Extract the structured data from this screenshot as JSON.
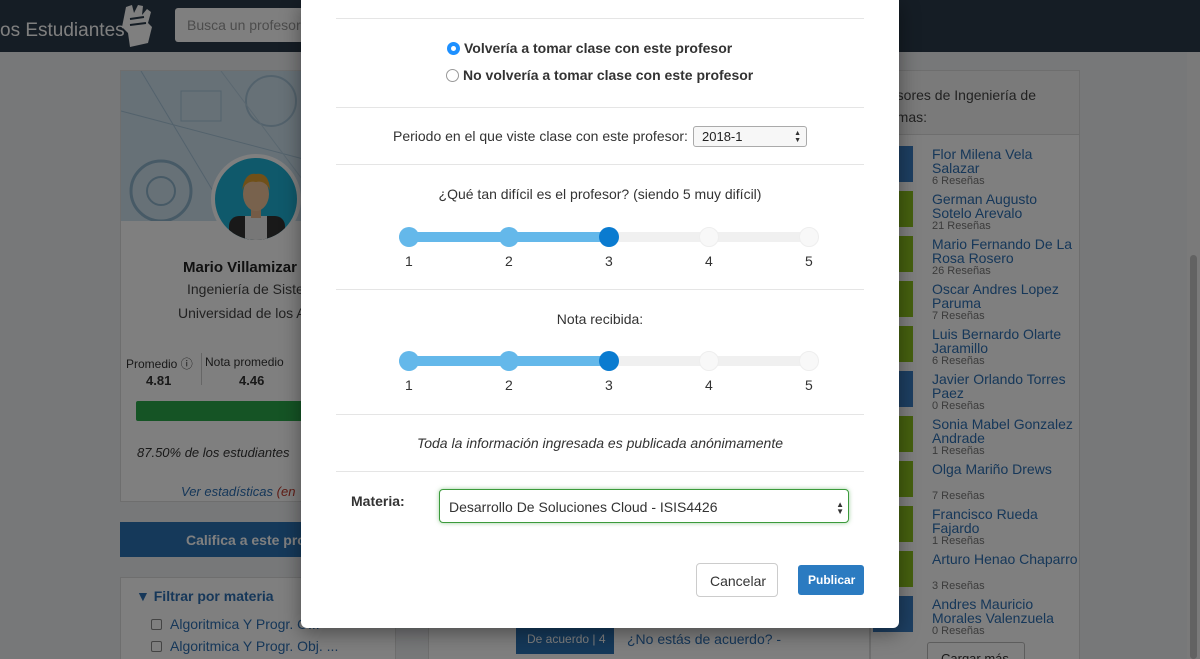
{
  "header": {
    "brand": "os Estudiantes",
    "search_placeholder": "Busca un profesor"
  },
  "profile": {
    "name": "Mario Villamizar",
    "department": "Ingeniería de Siste",
    "university": "Universidad de los A",
    "promedio_label": "Promedio",
    "promedio_value": "4.81",
    "nota_label": "Nota promedio",
    "nota_value": "4.46",
    "percent_text": "87.50% de los estudiantes",
    "stats_link": "Ver estadísticas",
    "stats_link_suffix": "(en",
    "rate_button": "Califica a este prof"
  },
  "filter": {
    "title": "Filtrar por materia",
    "items": [
      "Algoritmica Y Progr. O...",
      "Algoritmica Y Progr. Obj. ..."
    ]
  },
  "review": {
    "agree_button": "De acuerdo | 4",
    "disagree_link": "¿No estás de acuerdo?  -"
  },
  "sidebar": {
    "title": "fesores de Ingeniería de temas:",
    "load_more": "Cargar más",
    "professors": [
      {
        "name": "Flor Milena Vela Salazar",
        "reviews": "6 Reseñas",
        "color": "#3b7fc4"
      },
      {
        "name": "German Augusto Sotelo Arevalo",
        "reviews": "21 Reseñas",
        "color": "#8dc21f"
      },
      {
        "name": "Mario Fernando De La Rosa Rosero",
        "reviews": "26 Reseñas",
        "color": "#8dc21f"
      },
      {
        "name": "Oscar Andres Lopez Paruma",
        "reviews": "7 Reseñas",
        "color": "#8dc21f"
      },
      {
        "name": "Luis Bernardo Olarte Jaramillo",
        "reviews": "6 Reseñas",
        "color": "#8dc21f"
      },
      {
        "name": "Javier Orlando Torres Paez",
        "reviews": "0 Reseñas",
        "color": "#3b7fc4"
      },
      {
        "name": "Sonia Mabel Gonzalez Andrade",
        "reviews": "1 Reseñas",
        "color": "#8dc21f"
      },
      {
        "name": "Olga Mariño Drews",
        "reviews": "7 Reseñas",
        "color": "#8dc21f"
      },
      {
        "name": "Francisco Rueda Fajardo",
        "reviews": "1 Reseñas",
        "color": "#8dc21f"
      },
      {
        "name": "Arturo Henao Chaparro",
        "reviews": "3 Reseñas",
        "color": "#8dc21f"
      },
      {
        "name": "Andres Mauricio Morales Valenzuela",
        "reviews": "0 Reseñas",
        "color": "#3b7fc4"
      }
    ]
  },
  "modal": {
    "option_yes": "Volvería a tomar clase con este profesor",
    "option_no": "No volvería a tomar clase con este profesor",
    "selected_option": "yes",
    "period_label": "Periodo en el que viste clase con este profesor:",
    "period_value": "2018-1",
    "difficulty_label": "¿Qué tan difícil es el profesor? (siendo 5 muy difícil)",
    "difficulty_value": 3,
    "grade_label": "Nota recibida:",
    "grade_value": 3,
    "ticks": [
      "1",
      "2",
      "3",
      "4",
      "5"
    ],
    "anon_note": "Toda la información ingresada es publicada anónimamente",
    "materia_label": "Materia:",
    "materia_value": "Desarrollo De Soluciones Cloud - ISIS4426",
    "cancel_button": "Cancelar",
    "publish_button": "Publicar"
  },
  "colors": {
    "primary": "#2b7bc1",
    "slider_fill": "#64b8ea",
    "slider_handle": "#0a7bd0",
    "navbar": "#2b3a4a",
    "success": "#2aa94a"
  }
}
